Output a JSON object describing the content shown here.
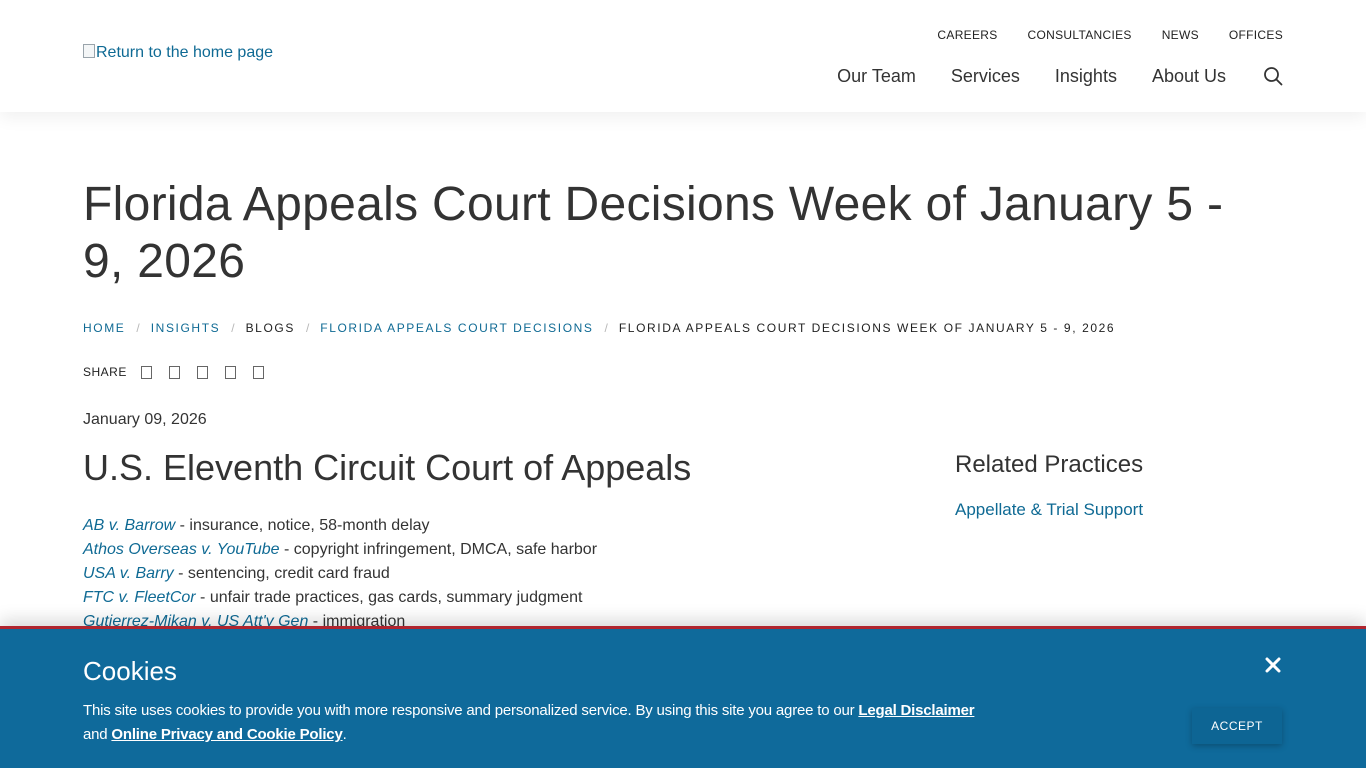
{
  "header": {
    "logo_alt": "Return to the home page",
    "utility_nav": [
      "CAREERS",
      "CONSULTANCIES",
      "NEWS",
      "OFFICES"
    ],
    "main_nav": [
      "Our Team",
      "Services",
      "Insights",
      "About Us"
    ],
    "search_icon": "search-icon"
  },
  "page": {
    "title": "Florida Appeals Court Decisions Week of January 5 - 9, 2026",
    "breadcrumb": {
      "home": "HOME",
      "insights": "INSIGHTS",
      "blogs": "BLOGS",
      "florida": "FLORIDA APPEALS COURT DECISIONS",
      "current": "FLORIDA APPEALS COURT DECISIONS WEEK OF JANUARY 5 - 9, 2026"
    },
    "share_label": "SHARE",
    "share_icon_count": 5,
    "date": "January 09, 2026"
  },
  "article": {
    "heading": "U.S. Eleventh Circuit Court of Appeals",
    "cases": [
      {
        "name": "AB v. Barrow",
        "summary": " - insurance, notice, 58-month delay"
      },
      {
        "name": "Athos Overseas v. YouTube",
        "summary": " - copyright infringement, DMCA, safe harbor"
      },
      {
        "name": "USA v. Barry",
        "summary": " - sentencing, credit card fraud"
      },
      {
        "name": "FTC v. FleetCor",
        "summary": " - unfair trade practices, gas cards, summary judgment"
      },
      {
        "name": "Gutierrez-Mikan v. US Att'y Gen",
        "summary": " - immigration"
      }
    ]
  },
  "sidebar": {
    "heading": "Related Practices",
    "link": "Appellate & Trial Support"
  },
  "cookie": {
    "title": "Cookies",
    "text_before": "This site uses cookies to provide you with more responsive and personalized service. By using this site you agree to our ",
    "disclaimer_link": "Legal Disclaimer",
    "text_and": "and ",
    "privacy_link": "Online Privacy and Cookie Policy",
    "text_end": ".",
    "accept_label": "ACCEPT",
    "close_icon": "close-icon"
  },
  "colors": {
    "link": "#0f6a94",
    "banner": "#0f6a9b",
    "banner_border": "#b0252f",
    "text": "#333333"
  }
}
